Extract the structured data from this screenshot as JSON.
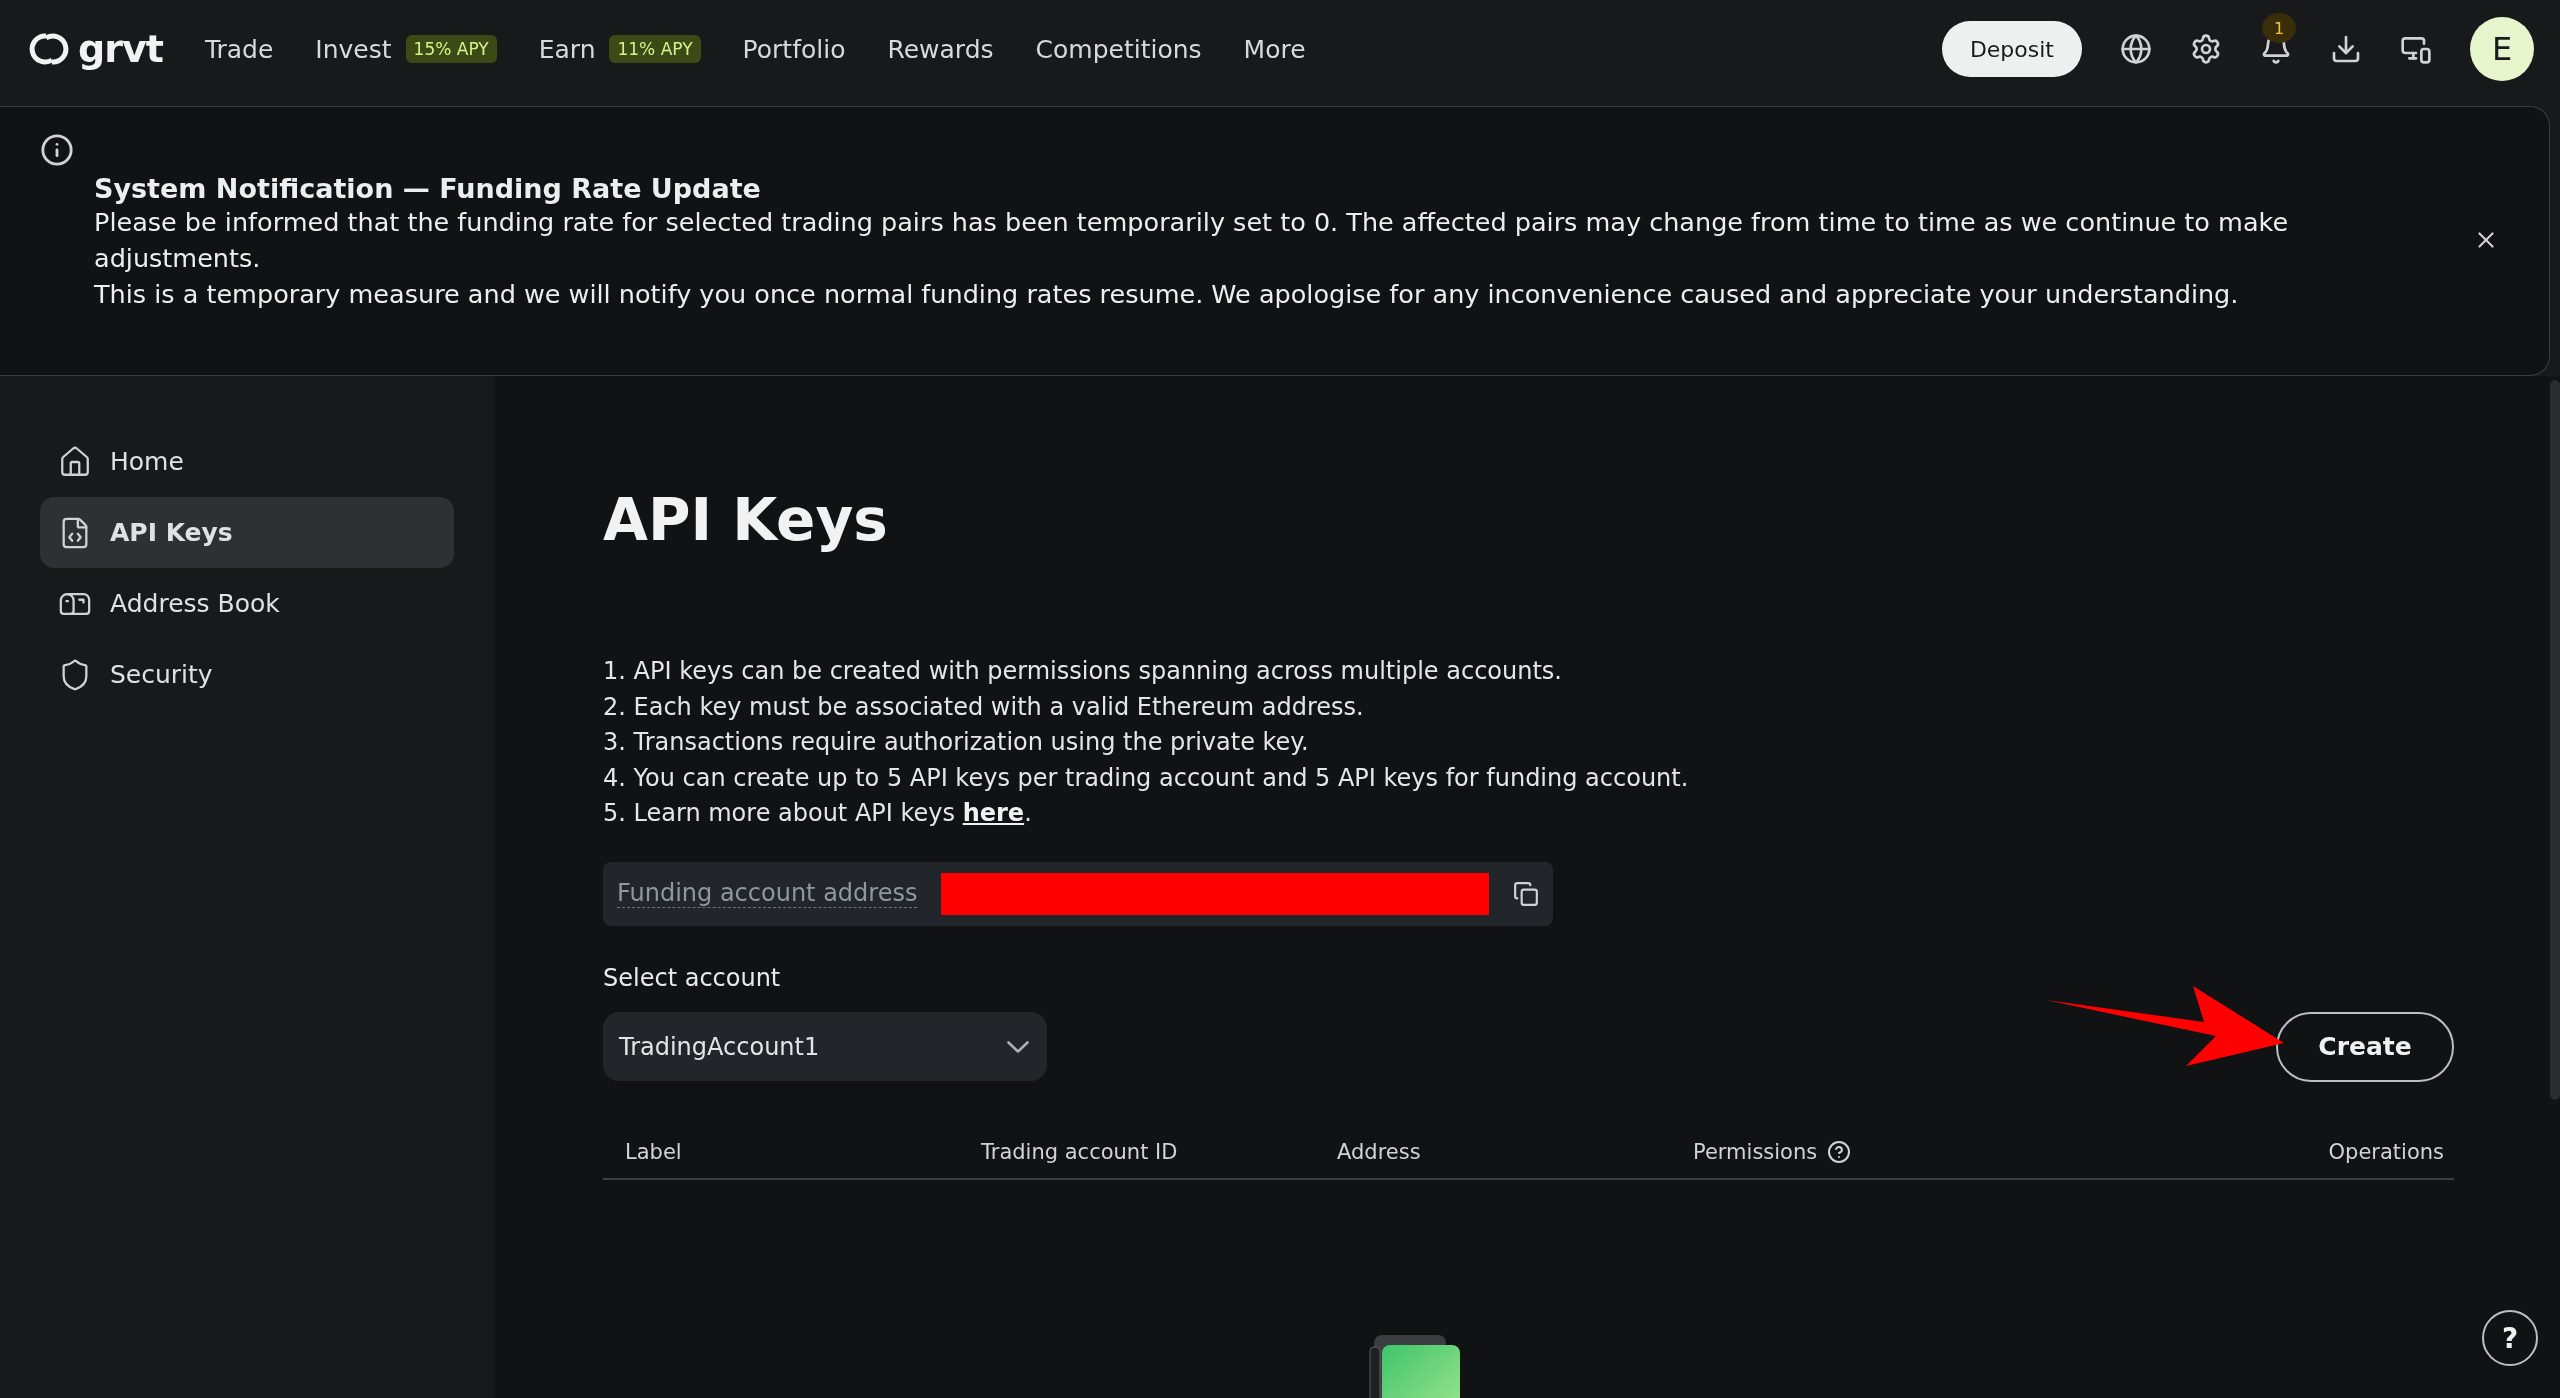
{
  "topbar": {
    "logo": "grvt",
    "nav": [
      {
        "label": "Trade"
      },
      {
        "label": "Invest",
        "badge": "15% APY"
      },
      {
        "label": "Earn",
        "badge": "11% APY"
      },
      {
        "label": "Portfolio"
      },
      {
        "label": "Rewards"
      },
      {
        "label": "Competitions"
      },
      {
        "label": "More"
      }
    ],
    "deposit": "Deposit",
    "notification_count": "1",
    "avatar": "E"
  },
  "notification": {
    "title": "System Notification — Funding Rate Update",
    "lines": [
      "Please be informed that the funding rate for selected trading pairs has been temporarily set to 0. The affected pairs may change from time to time as we continue to make adjustments.",
      "This is a temporary measure and we will notify you once normal funding rates resume. We apologise for any inconvenience caused and appreciate your understanding."
    ]
  },
  "sidebar": {
    "items": [
      {
        "label": "Home",
        "selected": false
      },
      {
        "label": "API Keys",
        "selected": true
      },
      {
        "label": "Address Book",
        "selected": false
      },
      {
        "label": "Security",
        "selected": false
      }
    ]
  },
  "content": {
    "title": "API Keys",
    "info": [
      {
        "text": "1. API keys can be created with permissions spanning across multiple accounts."
      },
      {
        "text": "2. Each key must be associated with a valid Ethereum address."
      },
      {
        "text": "3. Transactions require authorization using the private key."
      },
      {
        "text": "4. You can create up to 5 API keys per trading account and 5 API keys for funding account."
      },
      {
        "text": "5. Learn more about API keys ",
        "link": "here",
        "after": "."
      }
    ],
    "funding_label": "Funding account address",
    "select_label": "Select account",
    "select_value": "TradingAccount1",
    "create": "Create",
    "columns": [
      {
        "label": "Label"
      },
      {
        "label": "Trading account ID"
      },
      {
        "label": "Address"
      },
      {
        "label": "Permissions",
        "help": true
      },
      {
        "label": "Operations"
      }
    ]
  },
  "help_button": "?"
}
